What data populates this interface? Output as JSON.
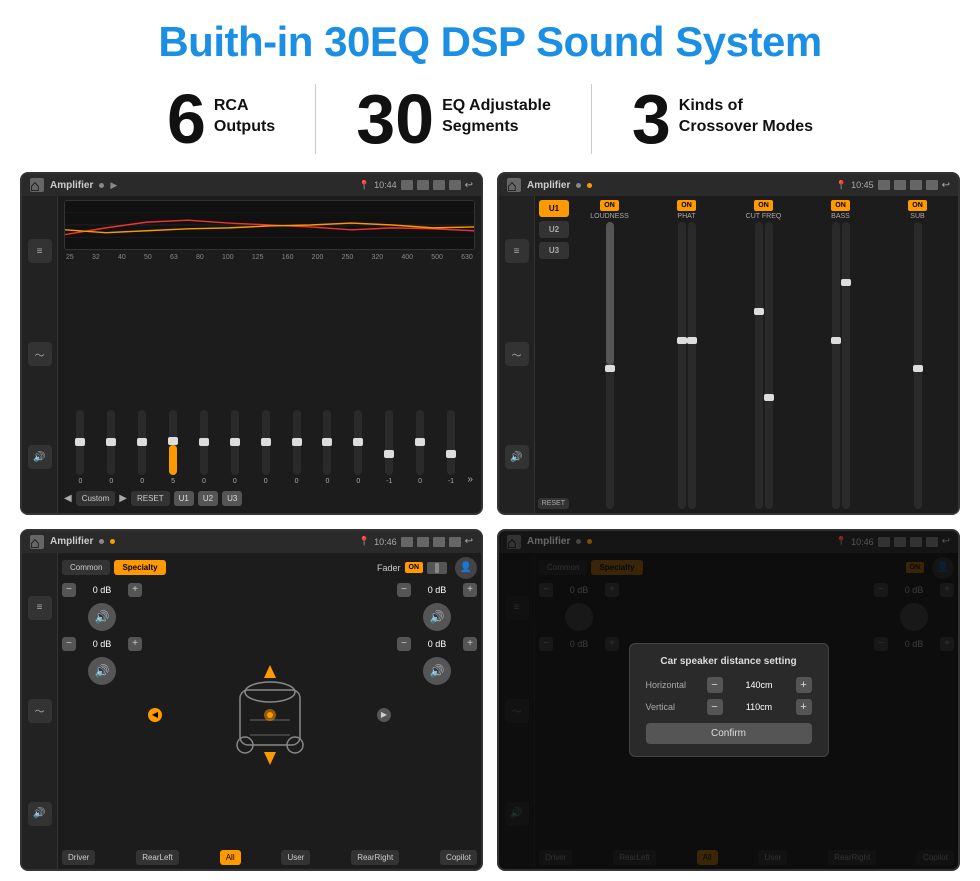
{
  "title": "Buith-in 30EQ DSP Sound System",
  "features": [
    {
      "number": "6",
      "line1": "RCA",
      "line2": "Outputs"
    },
    {
      "number": "30",
      "line1": "EQ Adjustable",
      "line2": "Segments"
    },
    {
      "number": "3",
      "line1": "Kinds of",
      "line2": "Crossover Modes"
    }
  ],
  "screens": [
    {
      "id": "screen1",
      "statusTitle": "Amplifier",
      "time": "10:44",
      "freqLabels": [
        "25",
        "32",
        "40",
        "50",
        "63",
        "80",
        "100",
        "125",
        "160",
        "200",
        "250",
        "320",
        "400",
        "500",
        "630"
      ],
      "sliderValues": [
        0,
        0,
        0,
        5,
        0,
        0,
        0,
        0,
        0,
        0,
        -1,
        0,
        -1
      ],
      "bottomBtns": [
        "Custom",
        "RESET",
        "U1",
        "U2",
        "U3"
      ]
    },
    {
      "id": "screen2",
      "statusTitle": "Amplifier",
      "time": "10:45",
      "presets": [
        "U1",
        "U2",
        "U3"
      ],
      "channels": [
        {
          "on": true,
          "label": "LOUDNESS"
        },
        {
          "on": true,
          "label": "PHAT"
        },
        {
          "on": true,
          "label": "CUT FREQ"
        },
        {
          "on": true,
          "label": "BASS"
        },
        {
          "on": true,
          "label": "SUB"
        }
      ]
    },
    {
      "id": "screen3",
      "statusTitle": "Amplifier",
      "time": "10:46",
      "tabs": [
        "Common",
        "Specialty"
      ],
      "activeTab": "Specialty",
      "faderLabel": "Fader",
      "faderOn": true,
      "dbValues": [
        "0 dB",
        "0 dB",
        "0 dB",
        "0 dB"
      ],
      "bottomBtns": [
        "Driver",
        "RearLeft",
        "All",
        "User",
        "RearRight",
        "Copilot"
      ]
    },
    {
      "id": "screen4",
      "statusTitle": "Amplifier",
      "time": "10:46",
      "tabs": [
        "Common",
        "Specialty"
      ],
      "activeTab": "Specialty",
      "dialog": {
        "title": "Car speaker distance setting",
        "horizontal": {
          "label": "Horizontal",
          "value": "140cm"
        },
        "vertical": {
          "label": "Vertical",
          "value": "110cm"
        },
        "confirm": "Confirm"
      },
      "bottomBtns": [
        "Driver",
        "RearLeft",
        "All",
        "User",
        "RearRight",
        "Copilot"
      ]
    }
  ]
}
